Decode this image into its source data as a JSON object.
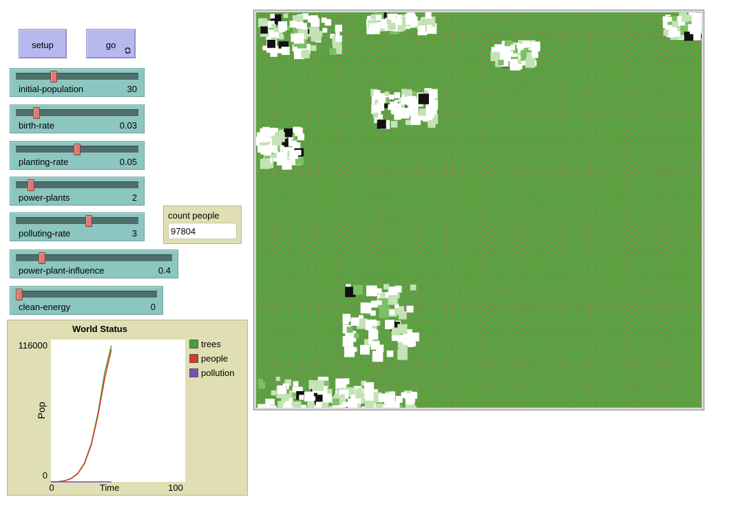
{
  "buttons": {
    "setup_label": "setup",
    "go_label": "go"
  },
  "sliders": [
    {
      "name": "initial-population",
      "value": "30",
      "fraction": 0.3
    },
    {
      "name": "birth-rate",
      "value": "0.03",
      "fraction": 0.15
    },
    {
      "name": "planting-rate",
      "value": "0.05",
      "fraction": 0.5
    },
    {
      "name": "power-plants",
      "value": "2",
      "fraction": 0.1
    },
    {
      "name": "polluting-rate",
      "value": "3",
      "fraction": 0.6
    },
    {
      "name": "power-plant-influence",
      "value": "0.4",
      "fraction": 0.15
    },
    {
      "name": "clean-energy",
      "value": "0",
      "fraction": 0.0
    }
  ],
  "monitor": {
    "label": "count people",
    "value": "97804"
  },
  "plot": {
    "title": "World Status",
    "ylabel": "Pop",
    "xlabel": "Time",
    "ytick_max": "116000",
    "ytick_min": "0",
    "xtick_min": "0",
    "xtick_max": "100"
  },
  "chart_data": {
    "type": "line",
    "title": "World Status",
    "xlabel": "Time",
    "ylabel": "Pop",
    "xlim": [
      0,
      100
    ],
    "ylim": [
      0,
      116000
    ],
    "legend": "right",
    "series": [
      {
        "name": "trees",
        "color": "#4a9e3c",
        "x": [
          0,
          5,
          10,
          15,
          20,
          25,
          30,
          35,
          40,
          45
        ],
        "values": [
          0,
          200,
          900,
          2800,
          7000,
          15500,
          31000,
          56000,
          89000,
          111000
        ]
      },
      {
        "name": "people",
        "color": "#d53a2a",
        "x": [
          0,
          5,
          10,
          15,
          20,
          25,
          30,
          35,
          40,
          45
        ],
        "values": [
          0,
          150,
          800,
          2600,
          6700,
          15000,
          30000,
          54000,
          84000,
          108000
        ]
      },
      {
        "name": "pollution",
        "color": "#7f4db5",
        "x": [
          0,
          5,
          10,
          15,
          20,
          25,
          30,
          35,
          40,
          45
        ],
        "values": [
          0,
          0,
          0,
          0,
          0,
          0,
          0,
          0,
          0,
          0
        ]
      }
    ]
  },
  "colors": {
    "button_bg": "#b7b8ee",
    "slider_bg": "#8cc6c0",
    "monitor_bg": "#e0dfb4",
    "world_green": "#56a440",
    "world_brown": "#a0795a"
  }
}
